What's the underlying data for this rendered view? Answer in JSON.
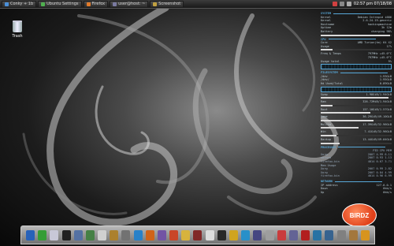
{
  "taskbar": {
    "tasks": [
      {
        "label": "Conky + 1b",
        "color": "#4a8fd8"
      },
      {
        "label": "Ubuntu Settings",
        "color": "#4fb04f"
      },
      {
        "label": "Firefox",
        "color": "#e07a2a"
      },
      {
        "label": "user@host: ~",
        "color": "#7a7aa0"
      },
      {
        "label": "Screenshot",
        "color": "#c0a040"
      }
    ],
    "clock": "02:57 pm  07/18/08"
  },
  "desktop": {
    "trash_label": "Trash"
  },
  "conky": {
    "system_header": "SYSTEM",
    "system": [
      {
        "k": "Kernel",
        "v": "Debian Intrepid i686"
      },
      {
        "k": "Kernel",
        "v": "2.6.24-19-generic"
      },
      {
        "k": "Hostname",
        "v": "hackingmachine"
      },
      {
        "k": "Uptime",
        "v": "3h 12m"
      },
      {
        "k": "Battery",
        "v": "charging 98%"
      }
    ],
    "cpu_header": "CPU",
    "cpu": [
      {
        "k": "Core",
        "v": "AMD Turion(tm) 64 X2"
      },
      {
        "k": "Usage",
        "v": "17%"
      },
      {
        "k": "Freq & Temps",
        "v": "797MHz  +45.0°C"
      },
      {
        "k": "",
        "v": "797MHz  +45.0°C"
      },
      {
        "k": "Usage total",
        "v": "9%"
      }
    ],
    "filesys_header": "FILESYSTEM",
    "filesys": [
      {
        "k": "/dev",
        "v": "1.93GiB"
      },
      {
        "k": "/dev/",
        "v": "1.95GiB"
      },
      {
        "k": "Hd Used/Total",
        "v": "0.89GiB"
      }
    ],
    "mem": [
      {
        "k": "Swap",
        "v": "1.98GiB/1.94GiB"
      },
      {
        "k": "Ram",
        "v": "326.72MiB/1.94GiB"
      },
      {
        "k": "Root",
        "v": "157.10GiB/1.57GiB"
      },
      {
        "k": "Home",
        "v": "36.29GiB/49.10GiB"
      },
      {
        "k": "Multim",
        "v": "17.39GiB/32.96GiB"
      },
      {
        "k": "Win",
        "v": "7.41GiB/32.96GiB"
      },
      {
        "k": "Backup",
        "v": "13.44GiB/49.04GiB"
      }
    ],
    "proc_header": "PROCESSES",
    "proc_cols": "PID  CPU  MEM",
    "procs": [
      {
        "name": "Xorg",
        "v": "2007  4.99  6.11"
      },
      {
        "name": "ubiqua",
        "v": "2007  0.93  1.13"
      },
      {
        "name": "firefox-bin",
        "v": "4014  0.67  3.71"
      },
      {
        "name": "Mem Usage",
        "v": ""
      },
      {
        "name": "Xorg",
        "v": "2007  0.99  2.82"
      },
      {
        "name": "Xorg",
        "v": "2007  0.84  4.99"
      },
      {
        "name": "firefox-bin",
        "v": "4014  0.96  6.99"
      }
    ],
    "net_header": "NETWORK",
    "net": [
      {
        "k": "IP address",
        "v": "127.0.0.1"
      },
      {
        "k": "Down",
        "v": "0kb/s"
      },
      {
        "k": "Up",
        "v": "0kb/s"
      }
    ]
  },
  "logo": {
    "text": "BIRDZ"
  },
  "dock": {
    "icons": [
      {
        "name": "ubuntu",
        "color": "#2a6ac8"
      },
      {
        "name": "download",
        "color": "#3aaa3a"
      },
      {
        "name": "mail",
        "color": "#d8d8e8"
      },
      {
        "name": "terminal",
        "color": "#222222"
      },
      {
        "name": "monitor",
        "color": "#5a7ab0"
      },
      {
        "name": "home",
        "color": "#4a8a4a"
      },
      {
        "name": "calendar",
        "color": "#e0e0e0"
      },
      {
        "name": "lock",
        "color": "#b88a30"
      },
      {
        "name": "tools",
        "color": "#7a7a7a"
      },
      {
        "name": "globe",
        "color": "#2a8ad8"
      },
      {
        "name": "firefox",
        "color": "#e06a1a"
      },
      {
        "name": "pidgin",
        "color": "#7a5ab0"
      },
      {
        "name": "chat",
        "color": "#d84a2a"
      },
      {
        "name": "edit",
        "color": "#e8c040"
      },
      {
        "name": "wine",
        "color": "#8a2a2a"
      },
      {
        "name": "text",
        "color": "#eeeeee"
      },
      {
        "name": "display",
        "color": "#2a2a2a"
      },
      {
        "name": "photos",
        "color": "#e0b020"
      },
      {
        "name": "skype",
        "color": "#2a9ad8"
      },
      {
        "name": "calc",
        "color": "#4a4a8a"
      },
      {
        "name": "volume",
        "color": "#aaaaaa"
      },
      {
        "name": "media",
        "color": "#d84040"
      },
      {
        "name": "settings",
        "color": "#6a6aa0"
      },
      {
        "name": "pdf",
        "color": "#c02020"
      },
      {
        "name": "network",
        "color": "#2a7ab0"
      },
      {
        "name": "graph",
        "color": "#3a6a9a"
      },
      {
        "name": "doc",
        "color": "#8a8a8a"
      },
      {
        "name": "stack",
        "color": "#b08040"
      },
      {
        "name": "smile",
        "color": "#e8a020"
      }
    ]
  }
}
